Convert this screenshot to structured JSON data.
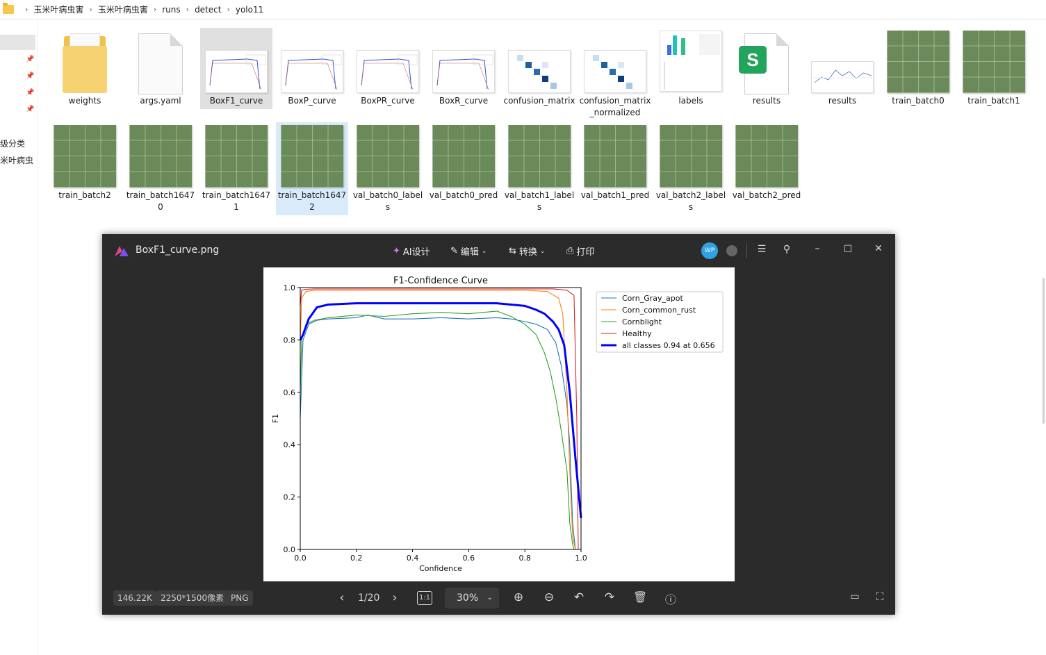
{
  "breadcrumb": [
    "玉米叶病虫害",
    "玉米叶病虫害",
    "runs",
    "detect",
    "yolo11"
  ],
  "nav": {
    "labels": [
      "级分类",
      "米叶病虫"
    ]
  },
  "files": [
    {
      "label": "weights",
      "kind": "folder"
    },
    {
      "label": "args.yaml",
      "kind": "doc"
    },
    {
      "label": "BoxF1_curve",
      "kind": "chart"
    },
    {
      "label": "BoxP_curve",
      "kind": "chart"
    },
    {
      "label": "BoxPR_curve",
      "kind": "chart"
    },
    {
      "label": "BoxR_curve",
      "kind": "chart"
    },
    {
      "label": "confusion_matrix",
      "kind": "matrix"
    },
    {
      "label": "confusion_matrix_normalized",
      "kind": "matrix"
    },
    {
      "label": "labels",
      "kind": "labels"
    },
    {
      "label": "results",
      "kind": "sheet"
    },
    {
      "label": "results",
      "kind": "results"
    },
    {
      "label": "train_batch0",
      "kind": "image"
    },
    {
      "label": "train_batch1",
      "kind": "image"
    },
    {
      "label": "train_batch2",
      "kind": "image"
    },
    {
      "label": "train_batch16470",
      "kind": "image"
    },
    {
      "label": "train_batch16471",
      "kind": "image"
    },
    {
      "label": "train_batch16472",
      "kind": "image"
    },
    {
      "label": "val_batch0_labels",
      "kind": "image"
    },
    {
      "label": "val_batch0_pred",
      "kind": "image"
    },
    {
      "label": "val_batch1_labels",
      "kind": "image"
    },
    {
      "label": "val_batch1_pred",
      "kind": "image"
    },
    {
      "label": "val_batch2_labels",
      "kind": "image"
    },
    {
      "label": "val_batch2_pred",
      "kind": "image"
    }
  ],
  "viewer": {
    "title": "BoxF1_curve.png",
    "toolbar": {
      "ai": "AI设计",
      "edit": "编辑",
      "convert": "转换",
      "print": "打印"
    },
    "avatar": "WP",
    "status": {
      "size": "146.22K",
      "dims": "2250*1500像素",
      "format": "PNG"
    },
    "page": "1/20",
    "zoom": "30%"
  },
  "chart_data": {
    "type": "line",
    "title": "F1-Confidence Curve",
    "xlabel": "Confidence",
    "ylabel": "F1",
    "xlim": [
      0,
      1
    ],
    "ylim": [
      0,
      1
    ],
    "xticks": [
      "0.0",
      "0.2",
      "0.4",
      "0.6",
      "0.8",
      "1.0"
    ],
    "yticks": [
      "0.0",
      "0.2",
      "0.4",
      "0.6",
      "0.8",
      "1.0"
    ],
    "legend_position": "top-right",
    "series": [
      {
        "name": "Corn_Gray_apot",
        "color": "#1f77b4",
        "x": [
          0,
          0.01,
          0.03,
          0.06,
          0.1,
          0.2,
          0.24,
          0.3,
          0.4,
          0.5,
          0.6,
          0.7,
          0.75,
          0.8,
          0.84,
          0.88,
          0.91,
          0.93,
          0.95,
          0.96,
          0.97,
          0.98
        ],
        "y": [
          0.5,
          0.8,
          0.86,
          0.875,
          0.88,
          0.885,
          0.895,
          0.88,
          0.88,
          0.885,
          0.88,
          0.885,
          0.88,
          0.87,
          0.86,
          0.84,
          0.79,
          0.7,
          0.55,
          0.4,
          0.1,
          0.0
        ]
      },
      {
        "name": "Corn_common_rust",
        "color": "#ff7f0e",
        "x": [
          0,
          0.005,
          0.02,
          0.05,
          0.1,
          0.2,
          0.3,
          0.4,
          0.5,
          0.6,
          0.7,
          0.8,
          0.88,
          0.92,
          0.935,
          0.95,
          0.96,
          0.97,
          0.98
        ],
        "y": [
          0.78,
          0.96,
          0.985,
          0.99,
          0.99,
          0.99,
          0.99,
          0.99,
          0.99,
          0.99,
          0.99,
          0.99,
          0.985,
          0.96,
          0.9,
          0.6,
          0.3,
          0.05,
          0.0
        ]
      },
      {
        "name": "Cornblight",
        "color": "#2ca02c",
        "x": [
          0,
          0.005,
          0.02,
          0.05,
          0.1,
          0.2,
          0.3,
          0.4,
          0.5,
          0.6,
          0.7,
          0.75,
          0.8,
          0.84,
          0.87,
          0.89,
          0.91,
          0.93,
          0.95,
          0.96,
          0.97,
          0.975
        ],
        "y": [
          0.6,
          0.8,
          0.86,
          0.875,
          0.885,
          0.895,
          0.89,
          0.9,
          0.905,
          0.9,
          0.91,
          0.89,
          0.86,
          0.82,
          0.75,
          0.68,
          0.58,
          0.45,
          0.3,
          0.1,
          0.02,
          0.0
        ]
      },
      {
        "name": "Healthy",
        "color": "#d62728",
        "x": [
          0,
          0.005,
          0.02,
          0.05,
          0.1,
          0.3,
          0.5,
          0.7,
          0.9,
          0.95,
          0.975,
          0.985,
          0.99
        ],
        "y": [
          0.93,
          0.99,
          0.993,
          0.995,
          0.995,
          0.995,
          0.995,
          0.995,
          0.995,
          0.99,
          0.97,
          0.5,
          0.0
        ]
      },
      {
        "name": "all classes 0.94 at 0.656",
        "color": "#0000ff",
        "bold": true,
        "x": [
          0,
          0.01,
          0.03,
          0.06,
          0.1,
          0.2,
          0.3,
          0.4,
          0.5,
          0.6,
          0.656,
          0.7,
          0.75,
          0.8,
          0.84,
          0.87,
          0.9,
          0.92,
          0.94,
          0.96,
          0.98,
          1.0
        ],
        "y": [
          0.8,
          0.82,
          0.88,
          0.925,
          0.935,
          0.94,
          0.94,
          0.94,
          0.94,
          0.94,
          0.94,
          0.94,
          0.935,
          0.93,
          0.915,
          0.9,
          0.87,
          0.84,
          0.78,
          0.6,
          0.35,
          0.12
        ]
      }
    ]
  }
}
